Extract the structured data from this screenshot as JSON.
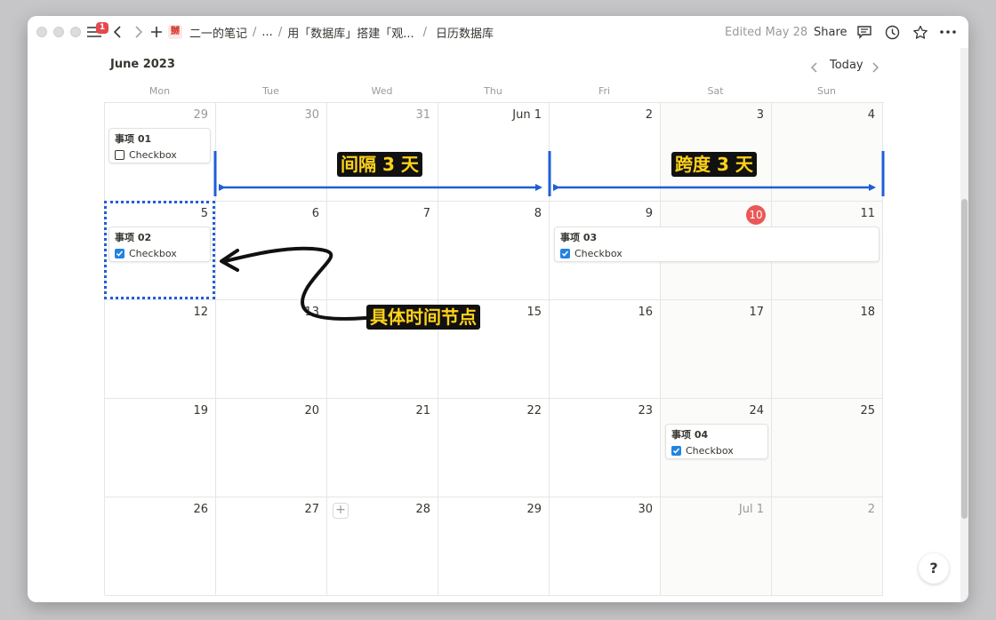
{
  "topbar": {
    "notification_count": "1",
    "page_icon": "嬲",
    "breadcrumbs": [
      "二一的笔记",
      "...",
      "用「数据库」搭建「观...",
      "日历数据库"
    ],
    "separator": "/",
    "edited": "Edited May 28",
    "share_label": "Share"
  },
  "calendar": {
    "month_label": "June 2023",
    "today_label": "Today",
    "weekdays": [
      "Mon",
      "Tue",
      "Wed",
      "Thu",
      "Fri",
      "Sat",
      "Sun"
    ],
    "weeks": [
      [
        "29",
        "30",
        "31",
        "Jun 1",
        "2",
        "3",
        "4"
      ],
      [
        "5",
        "6",
        "7",
        "8",
        "9",
        "10",
        "11"
      ],
      [
        "12",
        "13",
        "14",
        "15",
        "16",
        "17",
        "18"
      ],
      [
        "19",
        "20",
        "21",
        "22",
        "23",
        "24",
        "25"
      ],
      [
        "26",
        "27",
        "28",
        "29",
        "30",
        "Jul 1",
        "2"
      ]
    ],
    "today_date": "10",
    "events": [
      {
        "title": "事项 01",
        "property": "Checkbox",
        "checked": false,
        "date": "May 29",
        "span_days": 1
      },
      {
        "title": "事项 02",
        "property": "Checkbox",
        "checked": true,
        "date": "Jun 5",
        "span_days": 1
      },
      {
        "title": "事项 03",
        "property": "Checkbox",
        "checked": true,
        "date": "Jun 9",
        "span_days": 3
      },
      {
        "title": "事项 04",
        "property": "Checkbox",
        "checked": true,
        "date": "Jun 24",
        "span_days": 1
      }
    ]
  },
  "annotations": {
    "gap_label": "间隔 3 天",
    "span_label": "跨度 3 天",
    "point_label": "具体时间节点",
    "color_arrow": "#1f5fd6",
    "color_label_text": "#ffd21a",
    "color_label_bg": "#111111"
  },
  "help_label": "?",
  "colors": {
    "accent": "#2383e2",
    "today": "#eb5757",
    "weekend_bg": "#fbfbfa"
  }
}
